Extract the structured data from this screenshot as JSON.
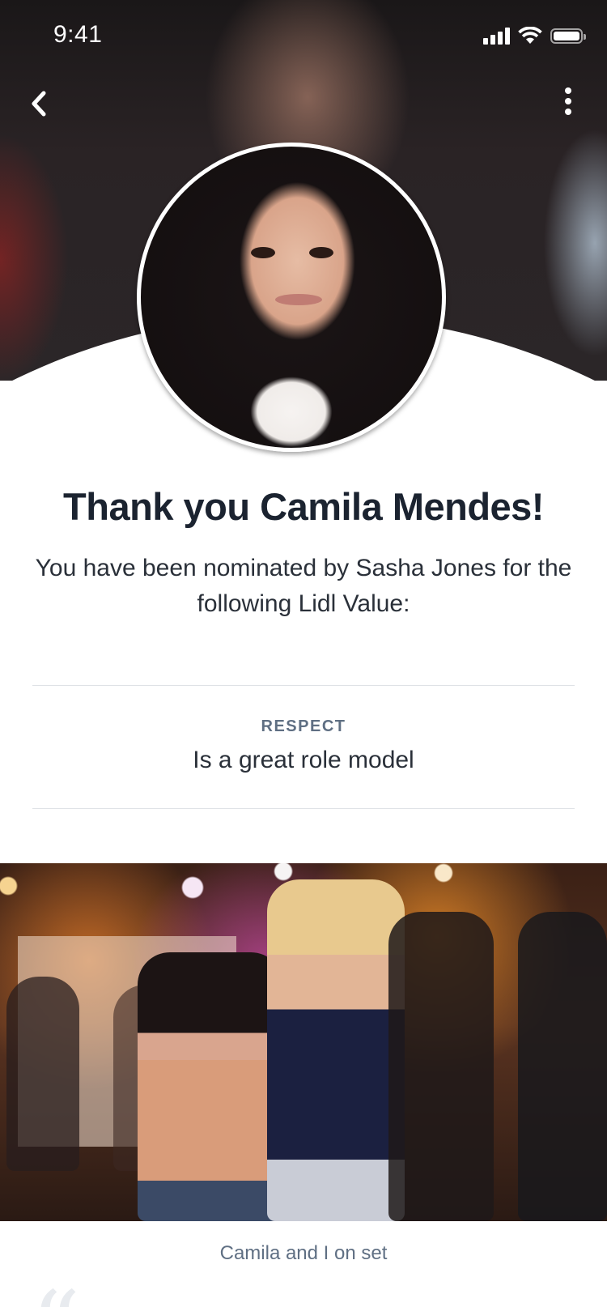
{
  "status_bar": {
    "time": "9:41",
    "icons": [
      "cellular-signal-icon",
      "wifi-icon",
      "battery-icon"
    ]
  },
  "nav": {
    "back_icon": "chevron-left-icon",
    "more_icon": "more-vertical-icon"
  },
  "profile": {
    "title": "Thank you Camila Mendes!",
    "subtitle": "You have been nominated by Sasha Jones for the following Lidl Value:"
  },
  "value": {
    "label": "RESPECT",
    "text": "Is a great role model"
  },
  "photo": {
    "caption": "Camila and I on set"
  },
  "quote": {
    "mark": "“"
  },
  "colors": {
    "title": "#1b2330",
    "body": "#2a3039",
    "muted": "#5f6f83",
    "divider": "#dfe2e6"
  }
}
